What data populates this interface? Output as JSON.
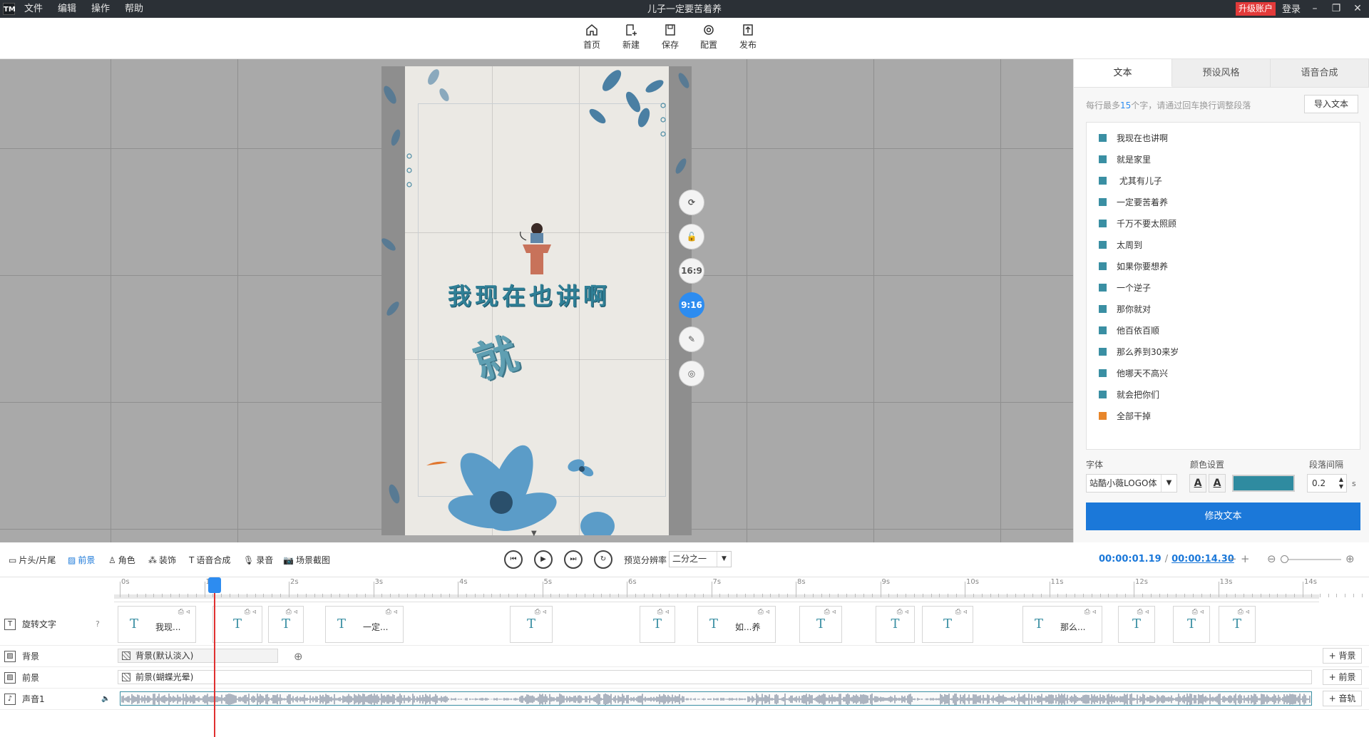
{
  "app": {
    "logo_text": "TM",
    "window_title": "儿子一定要苦着养",
    "menu": [
      "文件",
      "编辑",
      "操作",
      "帮助"
    ],
    "upgrade_label": "升级账户",
    "login_label": "登录",
    "window_buttons": [
      "–",
      "❐",
      "✕"
    ]
  },
  "toolbar": {
    "items": [
      {
        "label": "首页",
        "icon": "home-icon"
      },
      {
        "label": "新建",
        "icon": "new-file-icon"
      },
      {
        "label": "保存",
        "icon": "save-icon"
      },
      {
        "label": "配置",
        "icon": "config-icon"
      },
      {
        "label": "发布",
        "icon": "publish-icon"
      }
    ]
  },
  "canvas": {
    "main_text": "我现在也讲啊",
    "animated_char": "就",
    "side_controls": [
      {
        "name": "rotate-button",
        "label": "⟳"
      },
      {
        "name": "lock-button",
        "label": "🔓"
      },
      {
        "name": "ratio-16-9-button",
        "label": "16:9"
      },
      {
        "name": "ratio-9-16-button",
        "label": "9:16",
        "active": true
      },
      {
        "name": "edit-button",
        "label": "✎"
      },
      {
        "name": "target-button",
        "label": "◎"
      }
    ],
    "accent_color": "#2f7f96"
  },
  "right_panel": {
    "tabs": [
      "文本",
      "预设风格",
      "语音合成"
    ],
    "active_tab": 0,
    "hint_prefix": "每行最多",
    "hint_number": "15",
    "hint_suffix": "个字，请通过回车换行调整段落",
    "import_label": "导入文本",
    "lines": [
      "我现在也讲啊",
      "就是家里",
      " 尤其有儿子",
      "一定要苦着养",
      "千万不要太照顾",
      "太周到",
      "如果你要想养",
      "一个逆子",
      "那你就对",
      "他百依百顺",
      "那么养到30来岁",
      "他哪天不高兴",
      "就会把你们",
      "全部干掉"
    ],
    "font_label": "字体",
    "font_value": "站酷小薇LOGO体",
    "color_label": "颜色设置",
    "color_value": "#2f8ba0",
    "spacing_label": "段落间隔",
    "spacing_value": "0.2",
    "spacing_unit": "s",
    "modify_label": "修改文本"
  },
  "controlbar": {
    "tabs": [
      {
        "label": "片头/片尾",
        "icon": "▭"
      },
      {
        "label": "前景",
        "icon": "▨",
        "active": true
      },
      {
        "label": "角色",
        "icon": "♙"
      },
      {
        "label": "装饰",
        "icon": "⁂"
      },
      {
        "label": "语音合成",
        "icon": "T"
      },
      {
        "label": "录音",
        "icon": "🎙"
      },
      {
        "label": "场景截图",
        "icon": "📷"
      }
    ],
    "preview_label": "预览分辨率",
    "preview_value": "二分之一",
    "current_time": "00:00:01.19",
    "total_time": "00:00:14.30"
  },
  "timeline": {
    "ruler_labels": [
      "0s",
      "1s",
      "2s",
      "3s",
      "4s",
      "5s",
      "6s",
      "7s",
      "8s",
      "9s",
      "10s",
      "11s",
      "12s",
      "13s",
      "14s"
    ],
    "tracks": {
      "text_track": "旋转文字",
      "bg_track": "背景",
      "fg_track": "前景",
      "audio_track": "声音1"
    },
    "text_clips": [
      {
        "text": "我现..."
      },
      {
        "text": ""
      },
      {
        "text": ""
      },
      {
        "text": "一定..."
      },
      {
        "text": ""
      },
      {
        "text": ""
      },
      {
        "text": "如...养"
      },
      {
        "text": ""
      },
      {
        "text": ""
      },
      {
        "text": ""
      },
      {
        "text": "那么..."
      },
      {
        "text": ""
      },
      {
        "text": ""
      },
      {
        "text": ""
      }
    ],
    "bg_clip": "背景(默认淡入)",
    "fg_clip": "前景(蝴蝶光晕)",
    "add_bg": "+ 背景",
    "add_fg": "+ 前景",
    "add_audio": "+ 音轨"
  }
}
